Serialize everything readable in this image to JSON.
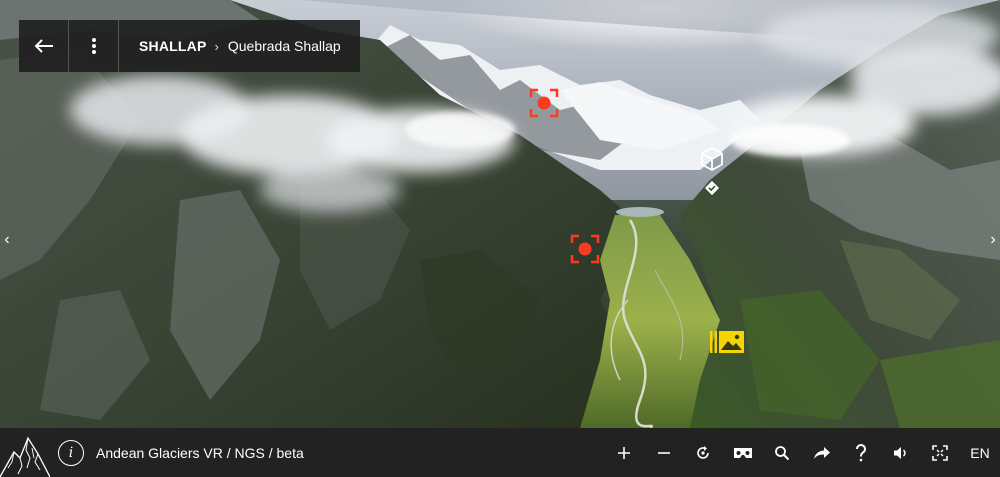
{
  "topbar": {
    "back_icon": "arrow-left-icon",
    "menu_icon": "vertical-dots-icon",
    "location_main": "SHALLAP",
    "separator": "›",
    "location_sub": "Quebrada Shallap"
  },
  "nav": {
    "prev_icon": "chevron-left-icon",
    "next_icon": "chevron-right-icon",
    "prev_glyph": "‹",
    "next_glyph": "›"
  },
  "hotspots": [
    {
      "icon": "target-hotspot-icon",
      "color": "#ff3b1f"
    },
    {
      "icon": "target-hotspot-icon",
      "color": "#ff3b1f"
    },
    {
      "icon": "cube-hotspot-icon",
      "color": "#ffffff"
    },
    {
      "icon": "check-diamond-icon",
      "color": "#ffffff"
    },
    {
      "icon": "gallery-hotspot-icon",
      "color": "#f5d400"
    }
  ],
  "bottombar": {
    "logo_icon": "mountain-logo-icon",
    "info_icon": "info-icon",
    "info_glyph": "i",
    "title": "Andean Glaciers VR / NGS / beta",
    "controls": [
      {
        "icon": "zoom-in-icon"
      },
      {
        "icon": "zoom-out-icon"
      },
      {
        "icon": "auto-rotate-icon"
      },
      {
        "icon": "vr-headset-icon"
      },
      {
        "icon": "search-icon"
      },
      {
        "icon": "share-icon"
      },
      {
        "icon": "help-icon"
      },
      {
        "icon": "volume-icon"
      },
      {
        "icon": "fullscreen-icon"
      }
    ],
    "language": "EN"
  },
  "colors": {
    "bar_bg": "#222222",
    "hotspot_red": "#ff3b1f",
    "hotspot_yellow": "#f5d400"
  }
}
